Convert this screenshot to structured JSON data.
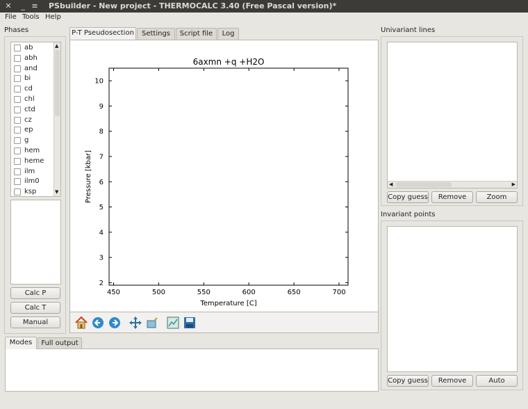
{
  "window": {
    "title": "PSbuilder - New project - THERMOCALC 3.40 (Free Pascal version)*",
    "controls": [
      "✕",
      "_",
      "≡"
    ]
  },
  "menu": [
    "File",
    "Tools",
    "Help"
  ],
  "phases": {
    "label": "Phases",
    "items": [
      "ab",
      "abh",
      "and",
      "bi",
      "cd",
      "chl",
      "ctd",
      "cz",
      "ep",
      "g",
      "hem",
      "heme",
      "ilm",
      "ilm0",
      "ksp"
    ],
    "buttons": {
      "calc_p": "Calc P",
      "calc_t": "Calc T",
      "manual": "Manual"
    }
  },
  "tabs": [
    "P-T Pseudosection",
    "Settings",
    "Script file",
    "Log"
  ],
  "active_tab": "P-T Pseudosection",
  "chart_data": {
    "type": "scatter",
    "title": "6axmn +q +H2O",
    "xlabel": "Temperature [C]",
    "ylabel": "Pressure [kbar]",
    "xlim": [
      445,
      710
    ],
    "ylim": [
      1.9,
      10.5
    ],
    "xticks": [
      450,
      500,
      550,
      600,
      650,
      700
    ],
    "yticks": [
      2,
      3,
      4,
      5,
      6,
      7,
      8,
      9,
      10
    ],
    "series": []
  },
  "plot_toolbar": [
    "home-icon",
    "back-arrow-icon",
    "forward-arrow-icon",
    "pan-icon",
    "zoom-icon",
    "configure-subplots-icon",
    "save-icon"
  ],
  "output_tabs": [
    "Modes",
    "Full output"
  ],
  "active_output_tab": "Modes",
  "univariant": {
    "label": "Univariant lines",
    "buttons": [
      "Copy guess",
      "Remove",
      "Zoom"
    ]
  },
  "invariant": {
    "label": "Invariant points",
    "buttons": [
      "Copy guess",
      "Remove",
      "Auto"
    ]
  },
  "colors": {
    "titlebar": "#3c3b37",
    "window_bg": "#e8e6e1",
    "icon_blue": "#2f8bc9"
  }
}
